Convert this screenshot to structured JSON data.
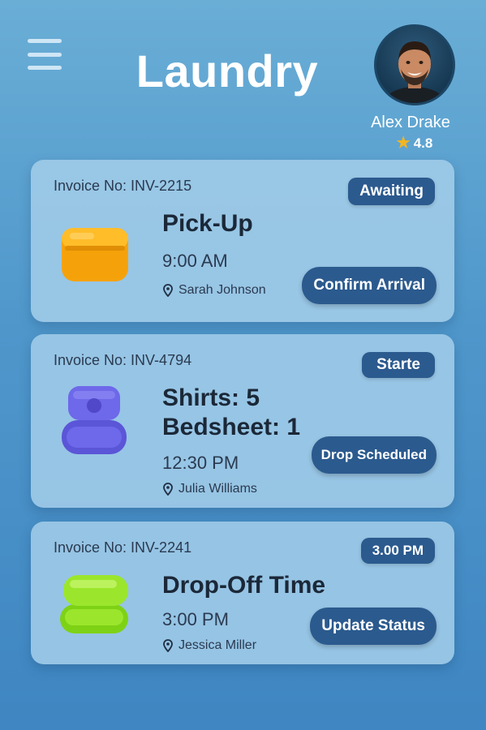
{
  "header": {
    "title": "Laundry",
    "menu_icon": "hamburger-menu-icon"
  },
  "profile": {
    "name": "Alex Drake",
    "rating": "4.8",
    "rating_icon": "star-icon"
  },
  "colors": {
    "accent": "#2b5a8e",
    "card": "#a2cce8",
    "star": "#f4b51e",
    "background": "#4f97cb"
  },
  "orders": [
    {
      "invoice": "Invoice No: INV-2215",
      "badge": "Awaiting",
      "icon": "box-icon",
      "title_lines": [
        "Pick-Up"
      ],
      "time": "9:00 AM",
      "person": "Sarah Johnson",
      "action": "Confirm Arrival"
    },
    {
      "invoice": "Invoice No: INV-4794",
      "badge": "Starte",
      "icon": "folded-laundry-icon",
      "title_lines": [
        "Shirts: 5",
        "Bedsheet: 1"
      ],
      "time": "12:30 PM",
      "person": "Julia Williams",
      "action": "Drop Scheduled"
    },
    {
      "invoice": "Invoice No: INV-2241",
      "badge": "3.00 PM",
      "icon": "folded-towels-icon",
      "title_lines": [
        "Drop-Off Time"
      ],
      "time": "3:00 PM",
      "person": "Jessica Miller",
      "action": "Update Status"
    }
  ]
}
